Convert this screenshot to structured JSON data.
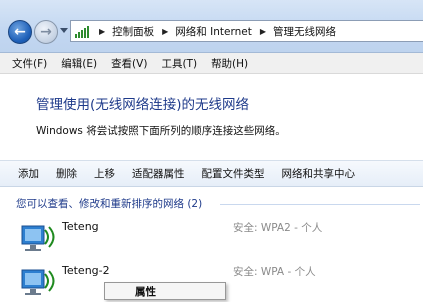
{
  "address_bar": {
    "crumbs": [
      "控制面板",
      "网络和 Internet",
      "管理无线网络"
    ]
  },
  "menu": {
    "items": [
      "文件(F)",
      "编辑(E)",
      "查看(V)",
      "工具(T)",
      "帮助(H)"
    ]
  },
  "header": {
    "title": "管理使用(无线网络连接)的无线网络",
    "description": "Windows 将尝试按照下面所列的顺序连接这些网络。"
  },
  "toolbar": {
    "buttons": [
      "添加",
      "删除",
      "上移",
      "适配器属性",
      "配置文件类型",
      "网络和共享中心"
    ]
  },
  "networks": {
    "group_header": "您可以查看、修改和重新排序的网络 (2)",
    "items": [
      {
        "name": "Teteng",
        "security": "安全: WPA2 - 个人"
      },
      {
        "name": "Teteng-2",
        "security": "安全: WPA - 个人"
      }
    ]
  },
  "context_menu": {
    "item": "属性"
  },
  "colors": {
    "title": "#1e3a8a",
    "chrome": "#c2d7f1",
    "signal_icon": "#2e8b2e"
  }
}
